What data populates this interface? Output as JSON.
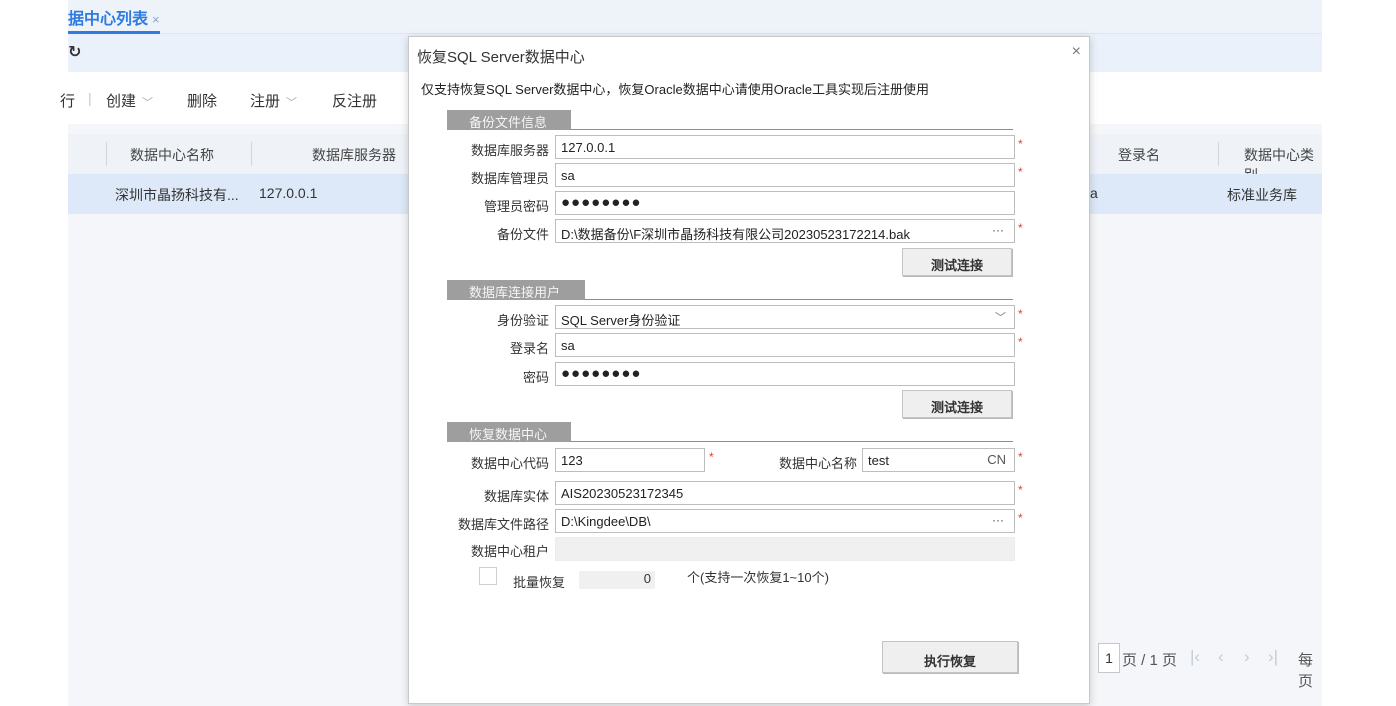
{
  "app": {
    "tab_title": "据中心列表",
    "tab_close": "×",
    "subbar_icon": "refresh-icon",
    "toolbar": {
      "partial_item": "行",
      "sep": "|",
      "create": "创建",
      "delete": "删除",
      "register": "注册",
      "unregister": "反注册"
    },
    "grid": {
      "columns": [
        "数据中心名称",
        "数据库服务器",
        "登录名",
        "数据中心类别"
      ],
      "row": {
        "name": "深圳市晶扬科技有...",
        "server": "127.0.0.1",
        "login_partial": "a",
        "category": "标准业务库"
      }
    },
    "pager": {
      "page": "1",
      "page_text": "页 / 1 页",
      "per_page_partial": "每页"
    }
  },
  "dialog": {
    "title": "恢复SQL Server数据中心",
    "close": "×",
    "notice": "仅支持恢复SQL Server数据中心，恢复Oracle数据中心请使用Oracle工具实现后注册使用",
    "backup_section": {
      "title": "备份文件信息",
      "db_server_label": "数据库服务器",
      "db_server_value": "127.0.0.1",
      "db_admin_label": "数据库管理员",
      "db_admin_value": "sa",
      "admin_pwd_label": "管理员密码",
      "admin_pwd_value": "●●●●●●●●",
      "backup_file_label": "备份文件",
      "backup_file_value": "D:\\数据备份\\F深圳市晶扬科技有限公司20230523172214.bak",
      "browse": "···",
      "test_button": "测试连接"
    },
    "user_section": {
      "title": "数据库连接用户",
      "auth_label": "身份验证",
      "auth_value": "SQL Server身份验证",
      "login_label": "登录名",
      "login_value": "sa",
      "pwd_label": "密码",
      "pwd_value": "●●●●●●●●",
      "test_button": "测试连接"
    },
    "restore_section": {
      "title": "恢复数据中心",
      "code_label": "数据中心代码",
      "code_value": "123",
      "name_label": "数据中心名称",
      "name_value": "test",
      "name_lang": "CN",
      "entity_label": "数据库实体",
      "entity_value": "AIS20230523172345",
      "path_label": "数据库文件路径",
      "path_value": "D:\\Kingdee\\DB\\",
      "browse": "···",
      "tenant_label": "数据中心租户",
      "tenant_value": "",
      "batch_label": "批量恢复",
      "batch_count": "0",
      "batch_hint": "个(支持一次恢复1~10个)"
    },
    "required_mark": "*",
    "execute_button": "执行恢复"
  }
}
